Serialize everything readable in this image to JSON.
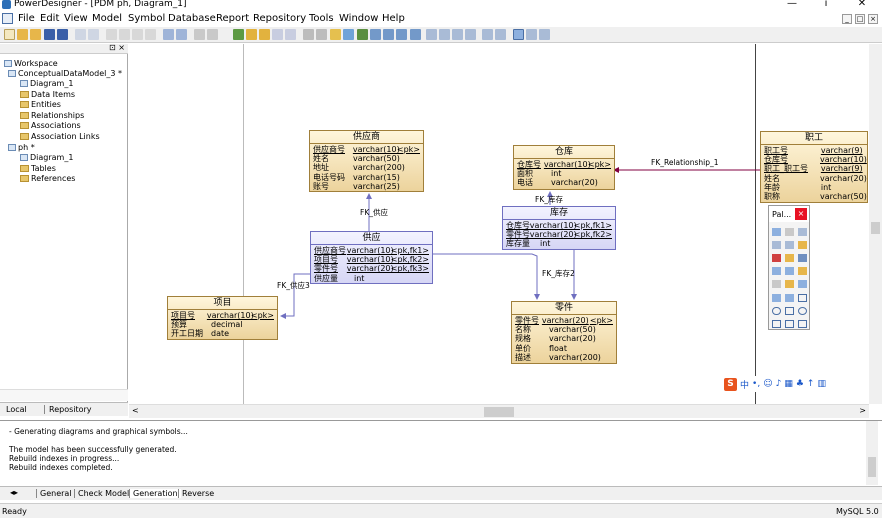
{
  "window": {
    "title": "PowerDesigner - [PDM ph, Diagram_1]",
    "minimize": "—",
    "maximize": "ı́",
    "close": "✕"
  },
  "menu": [
    "File",
    "Edit",
    "View",
    "Model",
    "Symbol",
    "Database",
    "Report",
    "Repository",
    "Tools",
    "Window",
    "Help"
  ],
  "mdi_controls": [
    "_",
    "□",
    "×"
  ],
  "explorer": {
    "tree": [
      {
        "label": "Workspace",
        "level": 0
      },
      {
        "label": "ConceptualDataModel_3 *",
        "level": 1
      },
      {
        "label": "Diagram_1",
        "level": 2
      },
      {
        "label": "Data Items",
        "level": 2
      },
      {
        "label": "Entities",
        "level": 2
      },
      {
        "label": "Relationships",
        "level": 2
      },
      {
        "label": "Associations",
        "level": 2
      },
      {
        "label": "Association Links",
        "level": 2
      },
      {
        "label": "ph *",
        "level": 1
      },
      {
        "label": "Diagram_1",
        "level": 2
      },
      {
        "label": "Tables",
        "level": 2
      },
      {
        "label": "References",
        "level": 2
      }
    ],
    "tabs": [
      "Local",
      "Repository"
    ]
  },
  "entities": {
    "supplier": {
      "title": "供应商",
      "rows": [
        {
          "name": "供应商号",
          "type": "varchar(10)",
          "key": "<pk>"
        },
        {
          "name": "姓名",
          "type": "varchar(50)",
          "key": ""
        },
        {
          "name": "地址",
          "type": "varchar(200)",
          "key": ""
        },
        {
          "name": "电话号码",
          "type": "varchar(15)",
          "key": ""
        },
        {
          "name": "账号",
          "type": "varchar(25)",
          "key": ""
        }
      ]
    },
    "warehouse": {
      "title": "仓库",
      "rows": [
        {
          "name": "仓库号",
          "type": "varchar(10)",
          "key": "<pk>"
        },
        {
          "name": "面积",
          "type": "int",
          "key": ""
        },
        {
          "name": "电话",
          "type": "varchar(20)",
          "key": ""
        }
      ]
    },
    "employee": {
      "title": "职工",
      "rows": [
        {
          "name": "职工号",
          "type": "varchar(9)",
          "key": ""
        },
        {
          "name": "仓库号",
          "type": "varchar(10)",
          "key": ""
        },
        {
          "name": "职工_职工号",
          "type": "varchar(9)",
          "key": ""
        },
        {
          "name": "姓名",
          "type": "varchar(20)",
          "key": ""
        },
        {
          "name": "年龄",
          "type": "int",
          "key": ""
        },
        {
          "name": "职称",
          "type": "varchar(50)",
          "key": ""
        }
      ]
    },
    "supply": {
      "title": "供应",
      "rows": [
        {
          "name": "供应商号",
          "type": "varchar(10)",
          "key": "<pk,fk1>"
        },
        {
          "name": "项目号",
          "type": "varchar(10)",
          "key": "<pk,fk2>"
        },
        {
          "name": "零件号",
          "type": "varchar(20)",
          "key": "<pk,fk3>"
        },
        {
          "name": "供应量",
          "type": "int",
          "key": ""
        }
      ]
    },
    "stock": {
      "title": "库存",
      "rows": [
        {
          "name": "仓库号",
          "type": "varchar(10)",
          "key": "<pk,fk1>"
        },
        {
          "name": "零件号",
          "type": "varchar(20)",
          "key": "<pk,fk2>"
        },
        {
          "name": "库存量",
          "type": "int",
          "key": ""
        }
      ]
    },
    "project": {
      "title": "项目",
      "rows": [
        {
          "name": "项目号",
          "type": "varchar(10)",
          "key": "<pk>"
        },
        {
          "name": "预算",
          "type": "decimal",
          "key": ""
        },
        {
          "name": "开工日期",
          "type": "date",
          "key": ""
        }
      ]
    },
    "part": {
      "title": "零件",
      "rows": [
        {
          "name": "零件号",
          "type": "varchar(20)",
          "key": "<pk>"
        },
        {
          "name": "名称",
          "type": "varchar(50)",
          "key": ""
        },
        {
          "name": "规格",
          "type": "varchar(20)",
          "key": ""
        },
        {
          "name": "单价",
          "type": "float",
          "key": ""
        },
        {
          "name": "描述",
          "type": "varchar(200)",
          "key": ""
        }
      ]
    }
  },
  "links": {
    "fk_relationship_1": "FK_Relationship_1",
    "fk_supply": "FK_供应",
    "fk_stock": "FK_库存",
    "fk_supply3": "FK_供应3",
    "fk_stock2": "FK_库存2"
  },
  "palette": {
    "title": "Pal...",
    "close": "×"
  },
  "ime": {
    "logo": "S",
    "mode": "中"
  },
  "output": {
    "lines": [
      "- Generating diagrams and graphical symbols...",
      "",
      "The model has been successfully generated.",
      "Rebuild indexes in progress...",
      "Rebuild indexes completed."
    ],
    "tabs": [
      "General",
      "Check Model",
      "Generation",
      "Reverse"
    ]
  },
  "status": {
    "left": "Ready",
    "right": "MySQL 5.0"
  },
  "colors": {
    "link": "#800040",
    "entity_fill": "#f3dfad",
    "assoc_fill": "#dcdcf7"
  }
}
